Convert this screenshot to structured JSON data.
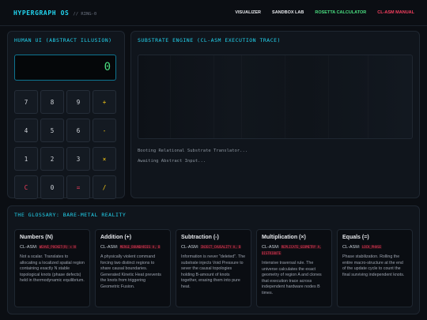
{
  "header": {
    "title": "HYPERGRAPH OS",
    "subtitle": "// RING-0",
    "nav": [
      {
        "label": "VISUALIZER",
        "color": "#e5e7eb"
      },
      {
        "label": "SANDBOX LAB",
        "color": "#e5e7eb"
      },
      {
        "label": "ROSETTA CALCULATOR",
        "color": "#4ade80"
      },
      {
        "label": "CL-ASM MANUAL",
        "color": "#f43f5e"
      }
    ]
  },
  "calculator": {
    "title": "HUMAN UI (ABSTRACT ILLUSION)",
    "display": "0",
    "keys": [
      "7",
      "8",
      "9",
      "+",
      "4",
      "5",
      "6",
      "-",
      "1",
      "2",
      "3",
      "×",
      "C",
      "0",
      "=",
      "/"
    ]
  },
  "engine": {
    "title": "SUBSTRATE ENGINE (CL-ASM EXECUTION TRACE)",
    "log": [
      "Booting Relational Substrate Translator...",
      "Awaiting Abstract Input..."
    ]
  },
  "glossary": {
    "title": "THE GLOSSARY: BARE-METAL REALITY",
    "asm_prefix": "CL-ASM:",
    "cards": [
      {
        "title": "Numbers (N)",
        "code": "WEAVE_POCKET(R) × N",
        "desc": "Not a scalar. Translates to allocating a localized spatial region containing exactly N stable topological knots (phase defects) held in thermodynamic equilibrium."
      },
      {
        "title": "Addition (+)",
        "code": "MERGE_BOUNDARIES A, B",
        "desc": "A physically violent command forcing two distinct regions to share causal boundaries. Generated Kinetic Heat prevents the knots from triggering Geometric Fusion."
      },
      {
        "title": "Subtraction (-)",
        "code": "INJECT_CAUSALITY A, B",
        "desc": "Information is never \"deleted\". The substrate injects Void Pressure to sever the causal topologies holding B-amount of knots together, erasing them into pure heat."
      },
      {
        "title": "Multiplication (×)",
        "code": "REPLICATE_GEOMETRY A, DISTRIBUTE",
        "desc": "Intensive traversal rule. The universe calculates the exact geometry of region A and clones that execution trace across independent hardware nodes B times."
      },
      {
        "title": "Equals (=)",
        "code": "LOCK_PHASE",
        "desc": "Phase stabilization. Rolling the entire macro-structure at the end of the update cycle to count the final surviving independent knots."
      }
    ]
  }
}
